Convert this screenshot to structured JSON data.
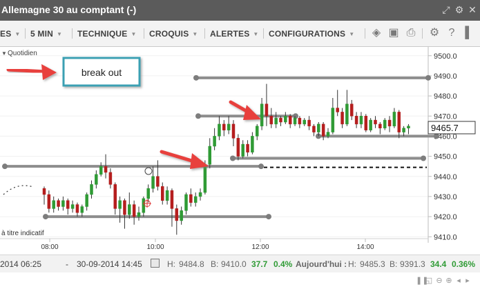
{
  "window": {
    "title": "Allemagne 30 au comptant (-)"
  },
  "titlebar_icons": [
    "expand-icon",
    "settings-icon",
    "close-icon"
  ],
  "toolbar": {
    "menus": [
      {
        "label": "ES",
        "partial": true
      },
      {
        "label": "5 MIN"
      },
      {
        "label": "TECHNIQUE"
      },
      {
        "label": "CROQUIS"
      },
      {
        "label": "ALERTES"
      },
      {
        "label": "CONFIGURATIONS"
      }
    ],
    "icons": [
      "layers-icon",
      "image-icon",
      "print-icon",
      "gear-icon",
      "help-icon",
      "pin-icon"
    ]
  },
  "chart": {
    "period_label": "Quotidien",
    "annotation_text": "break out",
    "note": "à titre indicatif",
    "current_price": "9465.7"
  },
  "chart_data": {
    "type": "candlestick",
    "y_ticks": [
      "9500.0",
      "9490.0",
      "9480.0",
      "9470.0",
      "9460.0",
      "9450.0",
      "9440.0",
      "9430.0",
      "9420.0",
      "9410.0"
    ],
    "ylim": [
      9407,
      9503
    ],
    "x_ticks": [
      "08:00",
      "10:00",
      "12:00",
      "14:00"
    ],
    "candles": [
      [
        9434,
        9431,
        9435,
        9426
      ],
      [
        9431,
        9424,
        9433,
        9422
      ],
      [
        9424,
        9428,
        9430,
        9422
      ],
      [
        9428,
        9425,
        9429,
        9423
      ],
      [
        9425,
        9428,
        9430,
        9423
      ],
      [
        9428,
        9424,
        9429,
        9421
      ],
      [
        9424,
        9426,
        9428,
        9422
      ],
      [
        9426,
        9422,
        9427,
        9420
      ],
      [
        9422,
        9425,
        9426,
        9420
      ],
      [
        9425,
        9431,
        9432,
        9423
      ],
      [
        9431,
        9436,
        9438,
        9429
      ],
      [
        9436,
        9441,
        9443,
        9434
      ],
      [
        9441,
        9445,
        9447,
        9440
      ],
      [
        9445,
        9442,
        9451,
        9439
      ],
      [
        9442,
        9436,
        9444,
        9434
      ],
      [
        9436,
        9424,
        9437,
        9421
      ],
      [
        9424,
        9428,
        9430,
        9417
      ],
      [
        9428,
        9421,
        9429,
        9414
      ],
      [
        9421,
        9426,
        9432,
        9419
      ],
      [
        9426,
        9420,
        9428,
        9416
      ],
      [
        9420,
        9422,
        9425,
        9418
      ],
      [
        9422,
        9429,
        9430,
        9420
      ],
      [
        9429,
        9434,
        9436,
        9427
      ],
      [
        9434,
        9440,
        9445,
        9432
      ],
      [
        9440,
        9435,
        9448,
        9433
      ],
      [
        9435,
        9428,
        9437,
        9426
      ],
      [
        9428,
        9433,
        9435,
        9426
      ],
      [
        9433,
        9424,
        9434,
        9415
      ],
      [
        9424,
        9418,
        9426,
        9411
      ],
      [
        9418,
        9423,
        9425,
        9416
      ],
      [
        9423,
        9431,
        9432,
        9421
      ],
      [
        9431,
        9427,
        9434,
        9425
      ],
      [
        9427,
        9430,
        9432,
        9425
      ],
      [
        9430,
        9432,
        9434,
        9428
      ],
      [
        9432,
        9446,
        9448,
        9431
      ],
      [
        9446,
        9455,
        9459,
        9444
      ],
      [
        9455,
        9460,
        9464,
        9453
      ],
      [
        9460,
        9466,
        9470,
        9458
      ],
      [
        9466,
        9463,
        9468,
        9460
      ],
      [
        9463,
        9466,
        9470,
        9461
      ],
      [
        9466,
        9459,
        9468,
        9455
      ],
      [
        9459,
        9450,
        9461,
        9448
      ],
      [
        9450,
        9456,
        9458,
        9449
      ],
      [
        9456,
        9452,
        9458,
        9450
      ],
      [
        9452,
        9460,
        9462,
        9451
      ],
      [
        9460,
        9465,
        9466,
        9458
      ],
      [
        9465,
        9476,
        9479,
        9463
      ],
      [
        9476,
        9470,
        9486,
        9465
      ],
      [
        9470,
        9466,
        9474,
        9464
      ],
      [
        9466,
        9469,
        9472,
        9464
      ],
      [
        9469,
        9467,
        9470,
        9465
      ],
      [
        9467,
        9470,
        9472,
        9466
      ],
      [
        9470,
        9466,
        9471,
        9464
      ],
      [
        9466,
        9469,
        9470,
        9465
      ],
      [
        9469,
        9466,
        9470,
        9464
      ],
      [
        9466,
        9468,
        9469,
        9465
      ],
      [
        9468,
        9465,
        9470,
        9463
      ],
      [
        9465,
        9462,
        9466,
        9460
      ],
      [
        9462,
        9466,
        9467,
        9460
      ],
      [
        9466,
        9460,
        9467,
        9458
      ],
      [
        9460,
        9462,
        9464,
        9459
      ],
      [
        9462,
        9474,
        9479,
        9461
      ],
      [
        9474,
        9472,
        9483,
        9470
      ],
      [
        9472,
        9466,
        9474,
        9464
      ],
      [
        9466,
        9476,
        9483,
        9465
      ],
      [
        9476,
        9470,
        9478,
        9468
      ],
      [
        9470,
        9466,
        9472,
        9464
      ],
      [
        9466,
        9470,
        9472,
        9464
      ],
      [
        9470,
        9463,
        9471,
        9462
      ],
      [
        9463,
        9468,
        9469,
        9462
      ],
      [
        9468,
        9466,
        9470,
        9464
      ],
      [
        9466,
        9464,
        9467,
        9461
      ],
      [
        9464,
        9468,
        9469,
        9463
      ],
      [
        9468,
        9465,
        9470,
        9462
      ],
      [
        9465,
        9472,
        9474,
        9464
      ],
      [
        9472,
        9462,
        9473,
        9459
      ],
      [
        9462,
        9464,
        9465,
        9460
      ],
      [
        9464,
        9465,
        9466,
        9461
      ]
    ],
    "horizontal_levels": [
      9489,
      9470,
      9460,
      9449,
      9445,
      9420
    ],
    "dashed_level": 9444.5
  },
  "status": {
    "start_date": "2014 06:25",
    "dash": "-",
    "end_date": "30-09-2014 14:45",
    "high_label": "H:",
    "high_value": "9484.8",
    "low_label": "B:",
    "low_value": "9410.0",
    "change": "37.7",
    "change_pct": "0.4%",
    "today_label": "Aujourd'hui :",
    "today_high_label": "H:",
    "today_high": "9485.3",
    "today_low_label": "B:",
    "today_low": "9391.3",
    "today_change": "34.4",
    "today_change_pct": "0.36%"
  },
  "colors": {
    "up": "#2f9b35",
    "down": "#b51e1e",
    "line": "#8d8d8d",
    "arrow": "#e8413d",
    "box_border": "#3aa0b3",
    "status_green": "#2f9b35",
    "titlebar": "#5b5b5b"
  }
}
